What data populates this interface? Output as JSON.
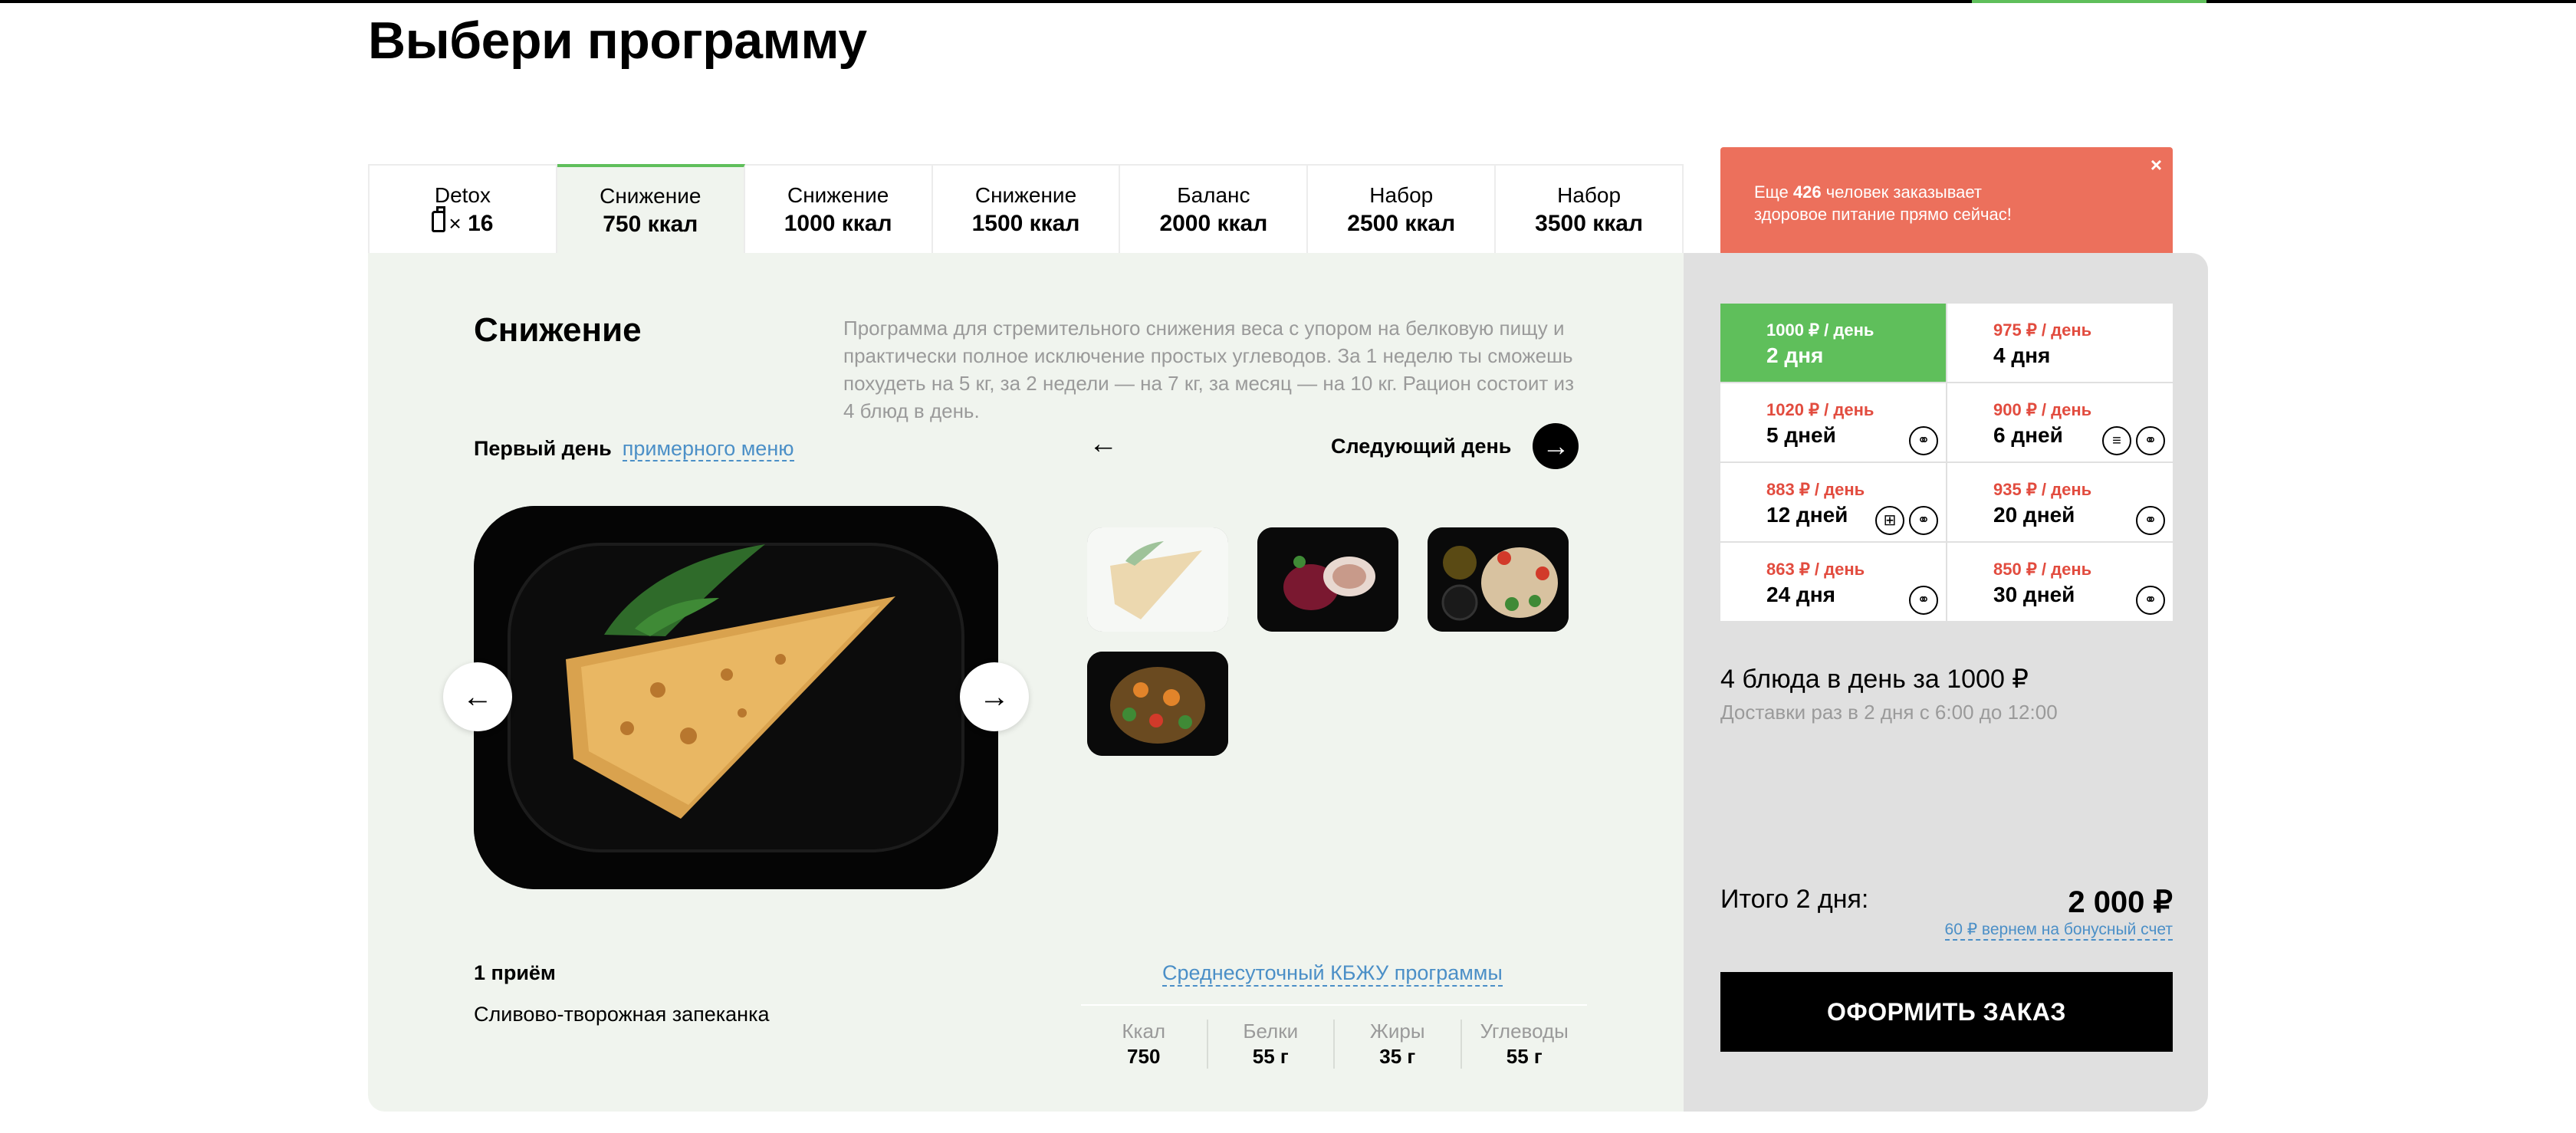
{
  "page": {
    "title": "Выбери программу"
  },
  "tabs": [
    {
      "line1": "Detox",
      "line2": "16",
      "times": "×",
      "icon": "bottle-icon",
      "active": false
    },
    {
      "line1": "Снижение",
      "line2": "750 ккал",
      "active": true
    },
    {
      "line1": "Снижение",
      "line2": "1000 ккал",
      "active": false
    },
    {
      "line1": "Снижение",
      "line2": "1500 ккал",
      "active": false
    },
    {
      "line1": "Баланс",
      "line2": "2000 ккал",
      "active": false
    },
    {
      "line1": "Набор",
      "line2": "2500 ккал",
      "active": false
    },
    {
      "line1": "Набор",
      "line2": "3500 ккал",
      "active": false
    }
  ],
  "notification": {
    "prefix": "Еще ",
    "count": "426",
    "suffix": " человек заказывает",
    "line2": "здоровое питание прямо сейчас!",
    "close": "×",
    "color": "#ec705c"
  },
  "program": {
    "title": "Снижение",
    "description": "Программа для стремительного снижения веса с упором на белковую пищу и практически полное исключение простых углеводов. За 1 неделю ты сможешь похудеть на 5 кг, за 2 недели — на 7 кг, за месяц — на 10 кг. Рацион состоит из 4 блюд в день.",
    "first_day": "Первый день",
    "menu_link": "примерного меню",
    "prev_arrow": "←",
    "next_day": "Следующий день",
    "next_arrow": "→",
    "photo_prev": "←",
    "photo_next": "→"
  },
  "meal": {
    "label": "1 приём",
    "name": "Сливово-творожная запеканка"
  },
  "kbzhu": {
    "link": "Среднесуточный КБЖУ программы",
    "items": [
      {
        "k": "Ккал",
        "v": "750"
      },
      {
        "k": "Белки",
        "v": "55 г"
      },
      {
        "k": "Жиры",
        "v": "35 г"
      },
      {
        "k": "Углеводы",
        "v": "55 г"
      }
    ]
  },
  "plans": [
    {
      "price": "1000 ₽ / день",
      "days": "2 дня",
      "active": true,
      "icons": []
    },
    {
      "price": "975 ₽ / день",
      "days": "4 дня",
      "active": false,
      "icons": []
    },
    {
      "price": "1020 ₽ / день",
      "days": "5 дней",
      "active": false,
      "icons": [
        "dumbbell-icon"
      ]
    },
    {
      "price": "900 ₽ / день",
      "days": "6 дней",
      "active": false,
      "icons": [
        "burger-icon",
        "dumbbell-icon"
      ]
    },
    {
      "price": "883 ₽ / день",
      "days": "12 дней",
      "active": false,
      "icons": [
        "gift-icon",
        "dumbbell-icon"
      ]
    },
    {
      "price": "935 ₽ / день",
      "days": "20 дней",
      "active": false,
      "icons": [
        "dumbbell-icon"
      ]
    },
    {
      "price": "863 ₽ / день",
      "days": "24 дня",
      "active": false,
      "icons": [
        "dumbbell-icon"
      ]
    },
    {
      "price": "850 ₽ / день",
      "days": "30 дней",
      "active": false,
      "icons": [
        "dumbbell-icon"
      ]
    }
  ],
  "summary": {
    "text": "4 блюда в день за 1000 ₽",
    "delivery": "Доставки раз в 2 дня с 6:00 до 12:00",
    "total_label": "Итого 2 дня:",
    "total_value": "2 000 ₽",
    "bonus": "60 ₽ вернем на бонусный счет",
    "order_button": "ОФОРМИТЬ ЗАКАЗ"
  },
  "colors": {
    "accent": "#5fbf5b",
    "price_red": "#e24c3f",
    "link": "#4b8fc7",
    "panel": "#f0f4ee",
    "side": "#e0e0e0"
  }
}
